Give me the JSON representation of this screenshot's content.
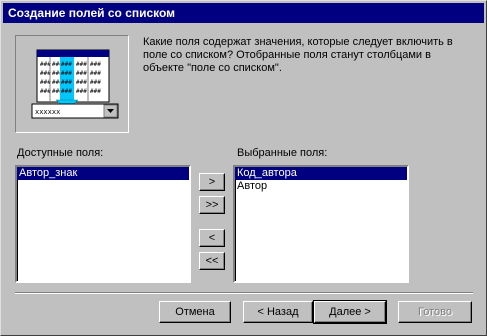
{
  "window": {
    "title": "Создание полей со списком"
  },
  "description": "Какие поля содержат значения, которые следует включить в поле со списком? Отобранные поля станут столбцами в объекте \"поле со списком\".",
  "illustration": {
    "combo_text": "xxxxxx"
  },
  "available": {
    "label": "Доступные поля:",
    "items": [
      "Автор_знак"
    ],
    "selected_index": 0
  },
  "selected": {
    "label": "Выбранные поля:",
    "items": [
      "Код_автора",
      "Автор"
    ],
    "selected_index": 0
  },
  "move_buttons": {
    "add_one": ">",
    "add_all": ">>",
    "remove_one": "<",
    "remove_all": "<<"
  },
  "footer": {
    "cancel": "Отмена",
    "back": "< Назад",
    "next": "Далее >",
    "finish": "Готово"
  },
  "colors": {
    "titlebar": "#000080",
    "selection": "#000080",
    "accent_arrow": "#00c8ff"
  }
}
